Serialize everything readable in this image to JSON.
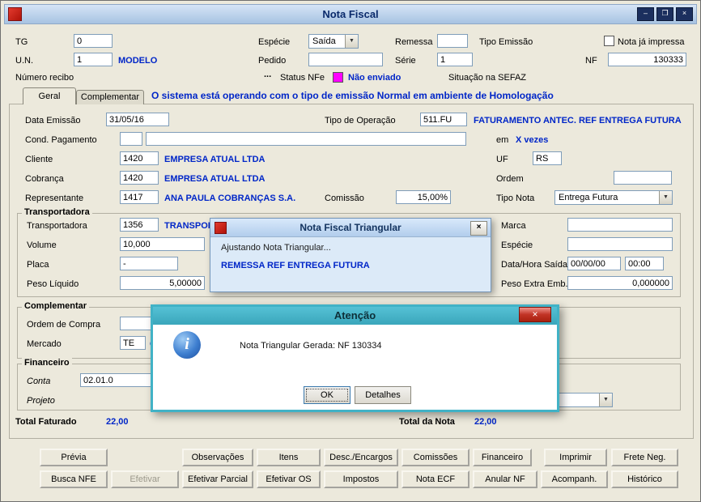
{
  "window": {
    "title": "Nota Fiscal",
    "controls": {
      "minimize": "–",
      "maximize": "❐",
      "close": "×"
    }
  },
  "topbar": {
    "tg_label": "TG",
    "tg_value": "0",
    "especie_label": "Espécie",
    "especie_value": "Saída",
    "remessa_label": "Remessa",
    "remessa_value": "",
    "tipo_emissao_label": "Tipo Emissão",
    "nota_impressa_label": "Nota já impressa",
    "un_label": "U.N.",
    "un_value": "1",
    "un_desc": "MODELO",
    "pedido_label": "Pedido",
    "pedido_value": "",
    "serie_label": "Série",
    "serie_value": "1",
    "nf_label": "NF",
    "nf_value": "130333",
    "numero_recibo_label": "Número recibo",
    "recibo_ellipsis": "...",
    "status_nfe_label": "Status NFe",
    "status_nfe_value": "Não enviado",
    "situacao_sefaz_label": "Situação na SEFAZ"
  },
  "tabs": {
    "geral": "Geral",
    "complementar": "Complementar"
  },
  "banner": "O sistema está operando com o tipo de emissão Normal em ambiente de Homologação",
  "geral": {
    "data_emissao_label": "Data Emissão",
    "data_emissao_value": "31/05/16",
    "tipo_operacao_label": "Tipo de Operação",
    "tipo_operacao_value": "511.FU",
    "tipo_operacao_desc": "FATURAMENTO ANTEC. REF ENTREGA FUTURA",
    "cond_pagamento_label": "Cond. Pagamento",
    "em_label": "em",
    "vezes_text": "X vezes",
    "cliente_label": "Cliente",
    "cliente_value": "1420",
    "cliente_desc": "EMPRESA ATUAL LTDA",
    "uf_label": "UF",
    "uf_value": "RS",
    "cobranca_label": "Cobrança",
    "cobranca_value": "1420",
    "cobranca_desc": "EMPRESA ATUAL LTDA",
    "ordem_label": "Ordem",
    "representante_label": "Representante",
    "representante_value": "1417",
    "representante_desc": "ANA PAULA COBRANÇAS S.A.",
    "comissao_label": "Comissão",
    "comissao_value": "15,00%",
    "tipo_nota_label": "Tipo Nota",
    "tipo_nota_value": "Entrega Futura"
  },
  "transportadora": {
    "group_label": "Transportadora",
    "transportadora_label": "Transportadora",
    "transportadora_value": "1356",
    "transportadora_desc": "TRANSPORTA",
    "volume_label": "Volume",
    "volume_value": "10,000",
    "placa_label": "Placa",
    "placa_value": "-",
    "peso_liquido_label": "Peso Líquido",
    "peso_liquido_value": "5,00000",
    "marca_label": "Marca",
    "marca_value": "",
    "especie_label": "Espécie",
    "especie_value": "",
    "data_hora_saida_label": "Data/Hora Saída",
    "data_saida_value": "00/00/00",
    "hora_saida_value": "00:00",
    "peso_extra_label": "Peso Extra Emb.",
    "peso_extra_value": "0,000000"
  },
  "complementar_group": {
    "group_label": "Complementar",
    "ordem_compra_label": "Ordem de Compra",
    "ordem_compra_value": "",
    "mercado_label": "Mercado",
    "mercado_value": "TE",
    "mercado_desc": "GA"
  },
  "financeiro_group": {
    "group_label": "Financeiro",
    "conta_label": "Conta",
    "conta_value": "02.01.0",
    "projeto_label": "Projeto"
  },
  "totals": {
    "total_faturado_label": "Total Faturado",
    "total_faturado_value": "22,00",
    "total_nota_label": "Total da Nota",
    "total_nota_value": "22,00"
  },
  "buttons_row1": [
    "Prévia",
    "Observações",
    "Itens",
    "Desc./Encargos",
    "Comissões",
    "Financeiro",
    "Imprimir",
    "Frete Neg."
  ],
  "buttons_row2": [
    "Busca NFE",
    "Efetivar",
    "Efetivar Parcial",
    "Efetivar OS",
    "Impostos",
    "Nota ECF",
    "Anular NF",
    "Acompanh.",
    "Histórico"
  ],
  "dialog_triangular": {
    "title": "Nota Fiscal Triangular",
    "close": "×",
    "line1": "Ajustando Nota Triangular...",
    "line2": "REMESSA REF ENTREGA FUTURA"
  },
  "dialog_atencao": {
    "title": "Atenção",
    "close": "×",
    "info_icon": "i",
    "message": "Nota Triangular Gerada: NF 130334",
    "ok_label": "OK",
    "detalhes_label": "Detalhes"
  },
  "colors": {
    "blue_text": "#0026c8",
    "status_magenta": "#ff00ff",
    "atencao_teal": "#41b2c6",
    "titlebar_blue": "#a7c3e2"
  }
}
